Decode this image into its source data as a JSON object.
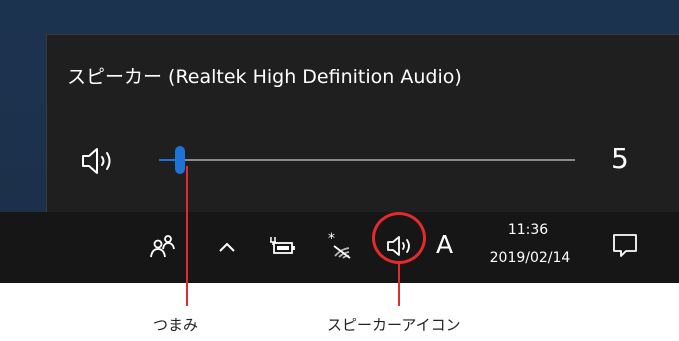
{
  "flyout": {
    "device_name": "スピーカー (Realtek High Definition Audio)",
    "speaker_icon": "speaker-icon",
    "volume": {
      "value": 5,
      "max": 100,
      "display": "5"
    },
    "accent_color": "#1e73d6"
  },
  "taskbar": {
    "icons": [
      "people-icon",
      "chevron-up-icon",
      "battery-icon",
      "wifi-off-icon",
      "speaker-icon",
      "notification-icon"
    ],
    "ime_mode": "A",
    "clock": {
      "time": "11:36",
      "date": "2019/02/14"
    }
  },
  "annotations": {
    "thumb_label": "つまみ",
    "speaker_label": "スピーカーアイコン",
    "highlight_color": "#e32b2b"
  }
}
